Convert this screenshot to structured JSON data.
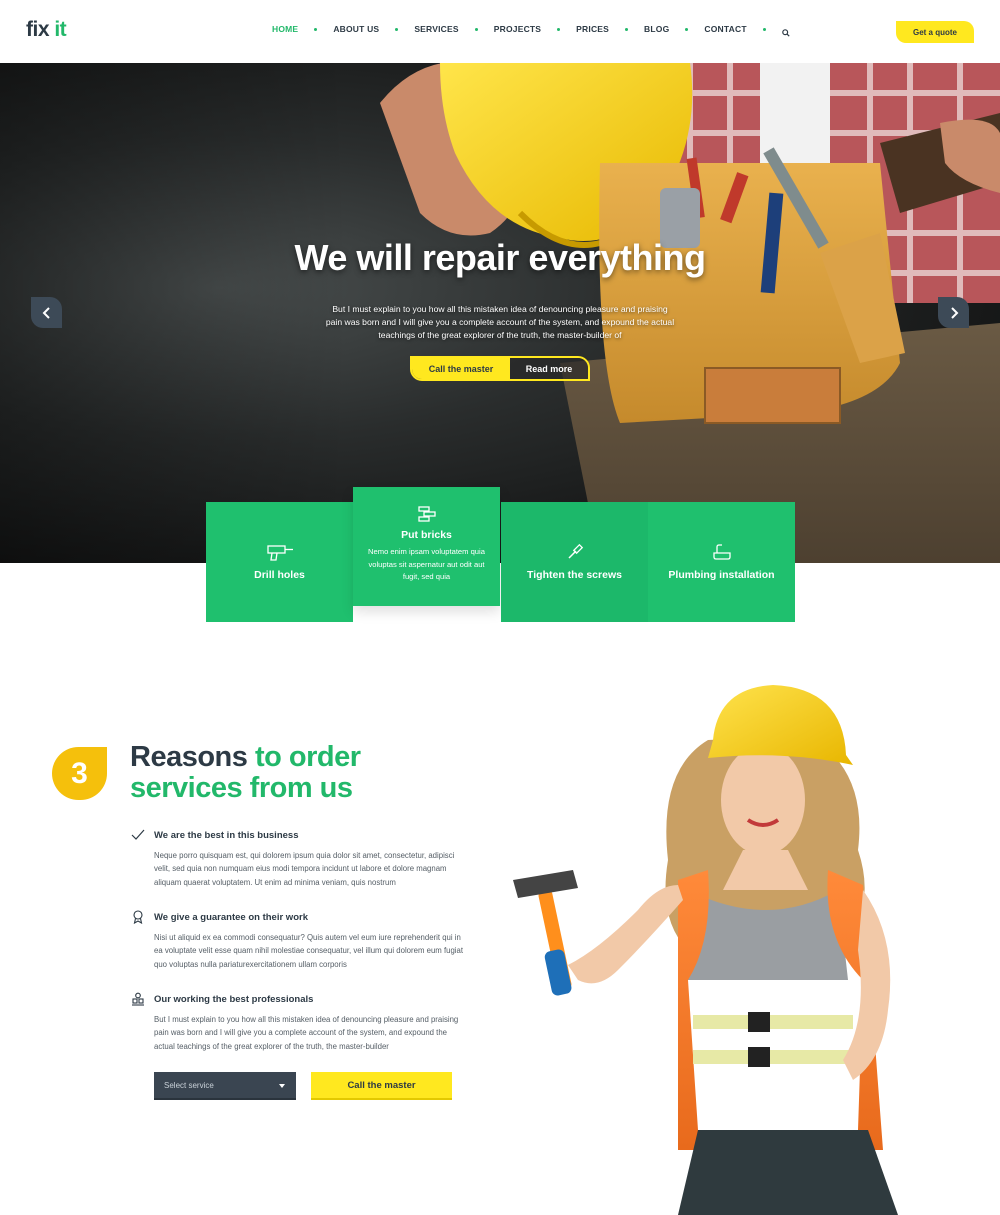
{
  "header": {
    "logo_main": "fix ",
    "logo_accent": "it",
    "nav": [
      "HOME",
      "ABOUT US",
      "SERVICES",
      "PROJECTS",
      "PRICES",
      "BLOG",
      "CONTACT"
    ],
    "active_nav": "HOME",
    "quote_label": "Get  a quote"
  },
  "hero": {
    "title": "We will repair everything",
    "description": "But I must explain to you how all this mistaken idea of denouncing pleasure and praising pain was born and I will give you a complete account of the system, and expound the actual teachings of the great explorer of the truth, the master-builder of",
    "primary_button": "Call the master",
    "secondary_button": "Read more"
  },
  "services": [
    {
      "title": "Drill holes",
      "icon": "drill-icon"
    },
    {
      "title": "Put bricks",
      "icon": "bricks-icon",
      "description": "Nemo enim ipsam voluptatem quia voluptas sit aspernatur aut odit aut fugit, sed quia"
    },
    {
      "title": "Tighten the screws",
      "icon": "screwdriver-icon"
    },
    {
      "title": "Plumbing installation",
      "icon": "plumbing-icon"
    }
  ],
  "reasons": {
    "number": "3",
    "title_dark": "Reasons ",
    "title_green_1": "to order",
    "title_green_2": "services from us",
    "items": [
      {
        "icon": "checkmark-icon",
        "title": "We are the best in this business",
        "text": "Neque porro quisquam est, qui dolorem ipsum quia dolor sit amet, consectetur, adipisci velit, sed quia non numquam eius modi tempora incidunt ut labore et dolore magnam aliquam quaerat voluptatem. Ut enim ad minima veniam, quis nostrum"
      },
      {
        "icon": "award-icon",
        "title": "We give a guarantee on their work",
        "text": "Nisi ut aliquid ex ea commodi consequatur? Quis autem vel eum iure reprehenderit qui in ea voluptate velit esse quam nihil molestiae consequatur, vel illum qui dolorem eum fugiat quo voluptas nulla pariaturexercitationem ullam corporis"
      },
      {
        "icon": "team-icon",
        "title": "Our working the best professionals",
        "text": "But I must explain to you how all this mistaken idea of denouncing pleasure and praising pain was born and I will give you a complete account of the system, and expound the actual teachings of the great explorer of the truth, the master-builder"
      }
    ],
    "select_placeholder": "Select service",
    "cta_label": "Call the master"
  },
  "colors": {
    "green": "#22b86a",
    "yellow": "#ffe81f",
    "dark": "#2d3a45",
    "badge": "#f5c00c"
  }
}
